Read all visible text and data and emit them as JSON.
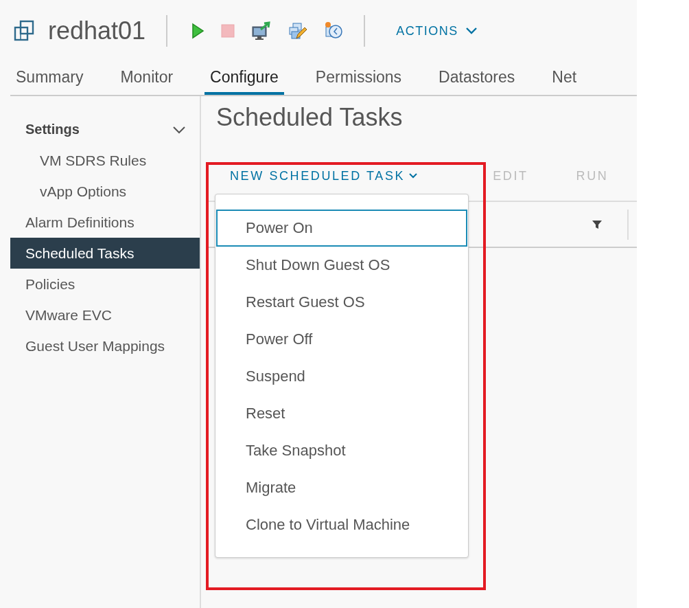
{
  "header": {
    "title": "redhat01",
    "actions_label": "ACTIONS",
    "icons": [
      {
        "kind": "power-on",
        "disabled": false
      },
      {
        "kind": "power-off",
        "disabled": true
      },
      {
        "kind": "console",
        "disabled": false
      },
      {
        "kind": "edit-settings",
        "disabled": false
      },
      {
        "kind": "snapshot",
        "disabled": false
      }
    ]
  },
  "tabs": [
    {
      "label": "Summary",
      "selected": false
    },
    {
      "label": "Monitor",
      "selected": false
    },
    {
      "label": "Configure",
      "selected": true
    },
    {
      "label": "Permissions",
      "selected": false
    },
    {
      "label": "Datastores",
      "selected": false
    },
    {
      "label": "Net",
      "selected": false
    }
  ],
  "sidebar": {
    "items": [
      {
        "label": "Settings",
        "kind": "group",
        "expanded": true,
        "selected": false,
        "children": [
          {
            "label": "VM SDRS Rules",
            "selected": false
          },
          {
            "label": "vApp Options",
            "selected": false
          }
        ]
      },
      {
        "label": "Alarm Definitions",
        "kind": "item",
        "selected": false
      },
      {
        "label": "Scheduled Tasks",
        "kind": "item",
        "selected": true
      },
      {
        "label": "Policies",
        "kind": "item",
        "selected": false
      },
      {
        "label": "VMware EVC",
        "kind": "item",
        "selected": false
      },
      {
        "label": "Guest User Mappings",
        "kind": "item",
        "selected": false
      }
    ]
  },
  "page_title": "Scheduled Tasks",
  "toolbar": [
    {
      "label": "NEW SCHEDULED TASK",
      "kind": "dropdown",
      "disabled": false
    },
    {
      "label": "EDIT",
      "kind": "button",
      "disabled": true
    },
    {
      "label": "RUN",
      "kind": "button",
      "disabled": true
    }
  ],
  "dropdown_menu": [
    {
      "label": "Power On",
      "selected": true
    },
    {
      "label": "Shut Down Guest OS",
      "selected": false
    },
    {
      "label": "Restart Guest OS",
      "selected": false
    },
    {
      "label": "Power Off",
      "selected": false
    },
    {
      "label": "Suspend",
      "selected": false
    },
    {
      "label": "Reset",
      "selected": false
    },
    {
      "label": "Take Snapshot",
      "selected": false
    },
    {
      "label": "Migrate",
      "selected": false
    },
    {
      "label": "Clone to Virtual Machine",
      "selected": false
    }
  ],
  "annotation": {
    "shown": true
  }
}
